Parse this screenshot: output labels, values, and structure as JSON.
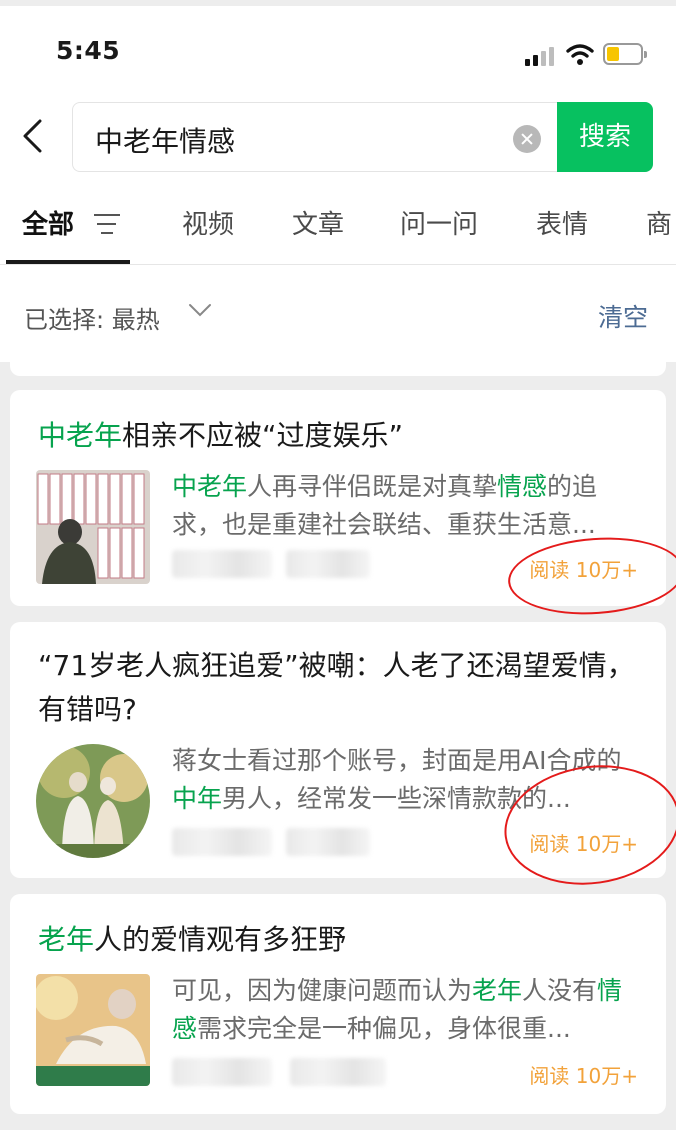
{
  "status_bar": {
    "time": "5:45"
  },
  "search": {
    "query": "中老年情感",
    "button_label": "搜索"
  },
  "tabs": [
    {
      "label": "全部"
    },
    {
      "label": "视频"
    },
    {
      "label": "文章"
    },
    {
      "label": "问一问"
    },
    {
      "label": "表情"
    },
    {
      "label": "商"
    }
  ],
  "filter": {
    "selected_prefix": "已选择:",
    "selected_value": "最热",
    "clear_label": "清空"
  },
  "results": [
    {
      "title_hl": "中老年",
      "title_rest": "相亲不应被“过度娱乐”",
      "summary_hl1": "中老年",
      "summary_mid1": "人再寻伴侣既是对真挚",
      "summary_hl2": "情感",
      "summary_rest": "的追求，也是重建社会联结、重获生活意...",
      "reads": "阅读 10万+"
    },
    {
      "title": "“71岁老人疯狂追爱”被嘲：人老了还渴望爱情，有错吗?",
      "summary_pre": "蒋女士看过那个账号，封面是用AI合成的",
      "summary_hl1": "中年",
      "summary_rest": "男人，经常发一些深情款款的...",
      "reads": "阅读 10万+"
    },
    {
      "title_hl": "老年",
      "title_rest": "人的爱情观有多狂野",
      "summary_pre": "可见，因为健康问题而认为",
      "summary_hl1": "老年",
      "summary_mid": "人没有",
      "summary_hl2": "情感",
      "summary_rest": "需求完全是一种偏见，身体很重...",
      "reads": "阅读 10万+"
    }
  ],
  "colors": {
    "accent": "#07c160",
    "highlight": "#07a34e",
    "reads": "#f2a23a",
    "annotation": "#e41b1b",
    "link": "#4c6b93"
  },
  "icons": [
    "back-icon",
    "clear-search-icon",
    "filter-icon",
    "chevron-down-icon",
    "signal-icon",
    "wifi-icon",
    "battery-icon"
  ]
}
